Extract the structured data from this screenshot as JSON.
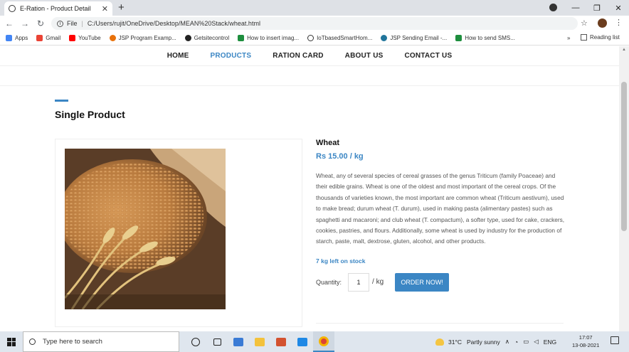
{
  "browser": {
    "tab_title": "E-Ration - Product Detail",
    "tab_close": "✕",
    "new_tab": "+",
    "url_scheme": "File",
    "url": "C:/Users/rujit/OneDrive/Desktop/MEAN%20Stack/wheat.html",
    "bookmarks": [
      {
        "label": "Apps",
        "color": "#4285f4"
      },
      {
        "label": "Gmail",
        "color": "#ea4335"
      },
      {
        "label": "YouTube",
        "color": "#ff0000"
      },
      {
        "label": "JSP Program Examp...",
        "color": "#e8710a"
      },
      {
        "label": "Getsitecontrol",
        "color": "#222222"
      },
      {
        "label": "How to insert imag...",
        "color": "#1e8e3e"
      },
      {
        "label": "IoTbasedSmartHom...",
        "color": "#333333"
      },
      {
        "label": "JSP Sending Email -...",
        "color": "#21759b"
      },
      {
        "label": "How to send SMS...",
        "color": "#1e8e3e"
      }
    ],
    "more_bookmarks": "»",
    "reading_list": "Reading list"
  },
  "site": {
    "nav": [
      {
        "label": "HOME",
        "active": false
      },
      {
        "label": "PRODUCTS",
        "active": true
      },
      {
        "label": "RATION CARD",
        "active": false
      },
      {
        "label": "ABOUT US",
        "active": false
      },
      {
        "label": "CONTACT US",
        "active": false
      }
    ],
    "section_title": "Single Product",
    "product": {
      "name": "Wheat",
      "price": "Rs 15.00 / kg",
      "description": "Wheat, any of several species of cereal grasses of the genus Triticum (family Poaceae) and their edible grains. Wheat is one of the oldest and most important of the cereal crops. Of the thousands of varieties known, the most important are common wheat (Triticum aestivum), used to make bread; durum wheat (T. durum), used in making pasta (alimentary pastes) such as spaghetti and macaroni; and club wheat (T. compactum), a softer type, used for cake, crackers, cookies, pastries, and flours. Additionally, some wheat is used by industry for the production of starch, paste, malt, dextrose, gluten, alcohol, and other products.",
      "stock": "7 kg left on stock",
      "quantity_label": "Quantity:",
      "quantity_value": "1",
      "quantity_unit": "/ kg",
      "order_button": "ORDER NOW!"
    },
    "accent_color": "#3b86c4"
  },
  "taskbar": {
    "search_placeholder": "Type here to search",
    "weather_temp": "31°C",
    "weather_desc": "Partly sunny",
    "language": "ENG",
    "time": "17:07",
    "date": "13-08-2021"
  }
}
